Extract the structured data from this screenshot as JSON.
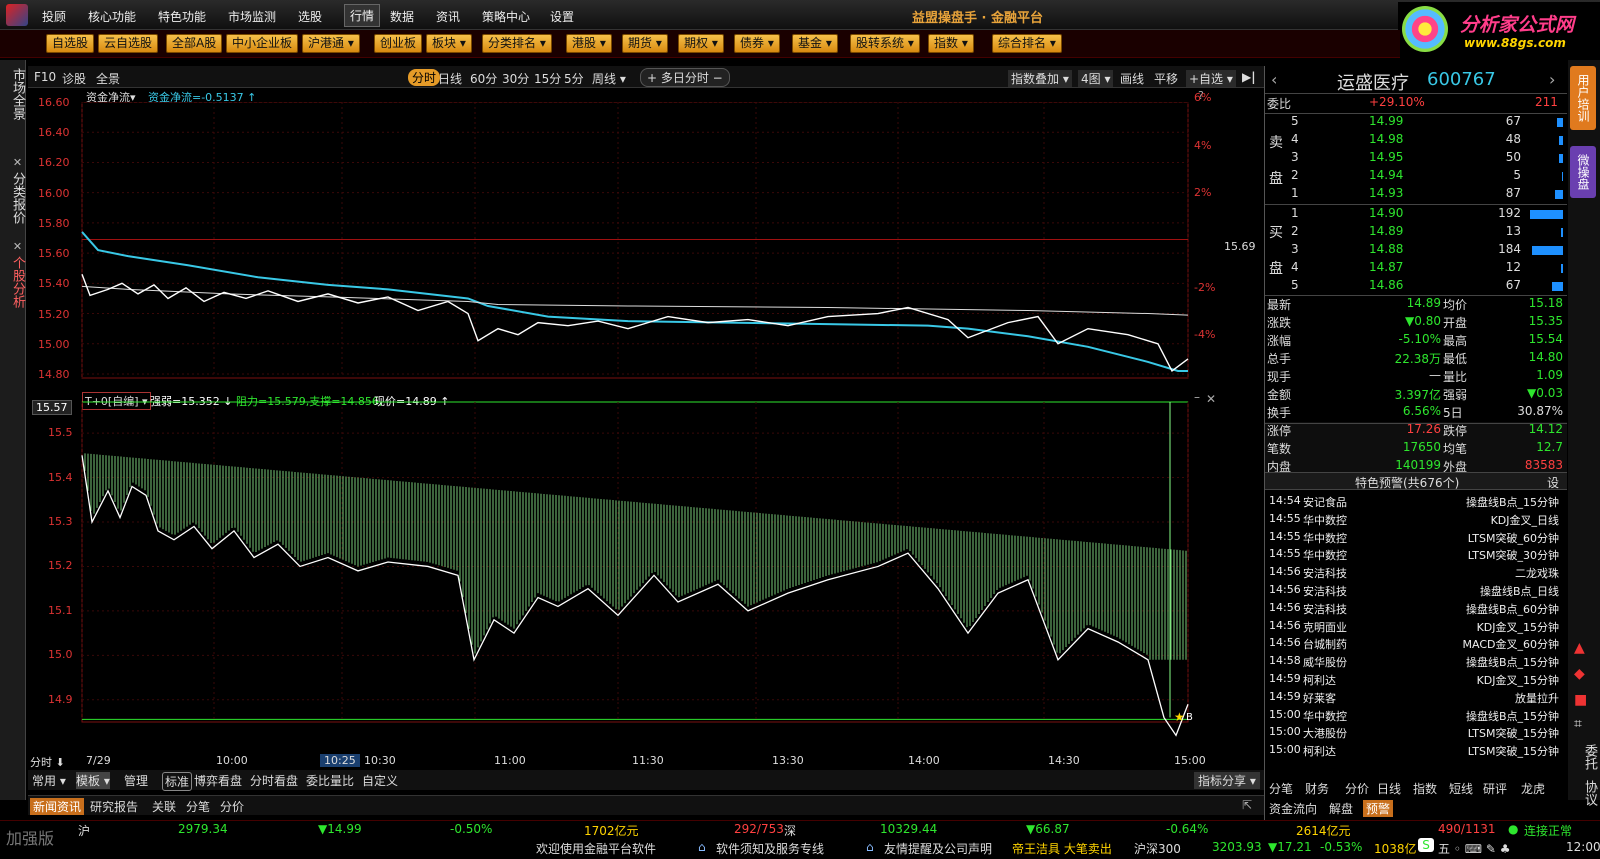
{
  "menu": {
    "items": [
      "投顾",
      "核心功能",
      "特色功能",
      "市场监测",
      "选股",
      "行情",
      "数据",
      "资讯",
      "策略中心",
      "设置"
    ],
    "active": "行情",
    "brand": "益盟操盘手 · 金融平台"
  },
  "site": {
    "name": "分析家公式网",
    "url": "www.88gs.com"
  },
  "toolbar": [
    "自选股",
    "云自选股",
    "全部A股",
    "中小企业板",
    "沪港通 ▾",
    "创业板",
    "板块 ▾",
    "分类排名 ▾",
    "港股 ▾",
    "期货 ▾",
    "期权 ▾",
    "债券 ▾",
    "基金 ▾",
    "股转系统 ▾",
    "指数 ▾",
    "综合排名 ▾"
  ],
  "left_tabs": [
    "市场全景",
    "分类报价",
    "个股分析"
  ],
  "right_tabs": [
    "用户培训",
    "微操盘"
  ],
  "right_icons": [
    "委托",
    "协议"
  ],
  "chart_bar": {
    "left": [
      "F10",
      "诊股",
      "全景"
    ],
    "periods": [
      "分时",
      "日线",
      "60分",
      "30分",
      "15分",
      "5分",
      "周线 ▾"
    ],
    "multiday": "+ 多日分时 −",
    "right": [
      "指数叠加 ▾",
      "4图 ▾",
      "画线",
      "平移",
      "+自选 ▾"
    ]
  },
  "upper_panel": {
    "indicator": "资金净流▾",
    "indicator_value": "资金净流=-0.5137 ↑",
    "price_ticks": [
      "16.60",
      "16.40",
      "16.20",
      "16.00",
      "15.80",
      "15.60",
      "15.40",
      "15.20",
      "15.00",
      "14.80"
    ],
    "pct_ticks": [
      "6%",
      "4%",
      "2%",
      "",
      "-2%",
      "-4%"
    ],
    "ref_price": "15.69",
    "help": "?"
  },
  "lower_panel": {
    "selector": "T+0[自编] ▾",
    "strength": "强弱=15.352 ↓",
    "resist": "阻力=15.579,支撑=14.856,",
    "price": "现价=14.89 ↑",
    "ticks": [
      "15.5",
      "15.4",
      "15.3",
      "15.2",
      "15.1",
      "15.0",
      "14.9"
    ],
    "top_value": "15.57",
    "marker": "B"
  },
  "time_axis": {
    "label": "分时 ⬇",
    "date": "7/29",
    "times": [
      "10:00",
      "10:25",
      "10:30",
      "11:00",
      "11:30",
      "13:30",
      "14:00",
      "14:30",
      "15:00"
    ]
  },
  "bottom_tabs": {
    "left": [
      "常用 ▾",
      "模板 ▾",
      "管理",
      "标准",
      "博弈看盘",
      "分时看盘",
      "委比量比",
      "自定义"
    ],
    "right": "指标分享 ▾"
  },
  "news_tabs": [
    "新闻资讯",
    "研究报告",
    "关联",
    "分笔",
    "分价"
  ],
  "quote": {
    "name": "运盛医疗",
    "code": "600767",
    "ratio_label": "委比",
    "ratio": "+29.10%",
    "ratio_num": "211",
    "sell": [
      {
        "lv": "5",
        "p": "14.99",
        "v": "67",
        "f": 0.1
      },
      {
        "lv": "4",
        "p": "14.98",
        "v": "48",
        "f": 0.07
      },
      {
        "lv": "3",
        "p": "14.95",
        "v": "50",
        "f": 0.07
      },
      {
        "lv": "2",
        "p": "14.94",
        "v": "5",
        "f": 0.02
      },
      {
        "lv": "1",
        "p": "14.93",
        "v": "87",
        "f": 0.13
      }
    ],
    "buy": [
      {
        "lv": "1",
        "p": "14.90",
        "v": "192",
        "f": 0.55
      },
      {
        "lv": "2",
        "p": "14.89",
        "v": "13",
        "f": 0.04
      },
      {
        "lv": "3",
        "p": "14.88",
        "v": "184",
        "f": 0.52
      },
      {
        "lv": "4",
        "p": "14.87",
        "v": "12",
        "f": 0.03
      },
      {
        "lv": "5",
        "p": "14.86",
        "v": "67",
        "f": 0.19
      }
    ],
    "sell_label": [
      "卖",
      "盘"
    ],
    "buy_label": [
      "买",
      "盘"
    ],
    "stats": [
      [
        "最新",
        "14.89",
        "均价",
        "15.18"
      ],
      [
        "涨跌",
        "▼0.80",
        "开盘",
        "15.35"
      ],
      [
        "涨幅",
        "-5.10%",
        "最高",
        "15.54"
      ],
      [
        "总手",
        "22.38万",
        "最低",
        "14.80"
      ],
      [
        "现手",
        "—",
        "量比",
        "1.09"
      ],
      [
        "金额",
        "3.397亿",
        "强弱",
        "▼0.03"
      ],
      [
        "换手",
        "6.56%",
        "5日",
        "30.87%"
      ],
      [
        "涨停",
        "17.26",
        "跌停",
        "14.12"
      ],
      [
        "笔数",
        "17650",
        "均笔",
        "12.7"
      ],
      [
        "内盘",
        "140199",
        "外盘",
        "83583"
      ]
    ]
  },
  "alerts": {
    "title": "特色预警(共676个)",
    "set": "设",
    "rows": [
      [
        "14:54",
        "安记食品",
        "操盘线B点_15分钟"
      ],
      [
        "14:55",
        "华中数控",
        "KDJ金叉_日线"
      ],
      [
        "14:55",
        "华中数控",
        "LTSM突破_60分钟"
      ],
      [
        "14:55",
        "华中数控",
        "LTSM突破_30分钟"
      ],
      [
        "14:56",
        "安洁科技",
        "二龙戏珠"
      ],
      [
        "14:56",
        "安洁科技",
        "操盘线B点_日线"
      ],
      [
        "14:56",
        "安洁科技",
        "操盘线B点_60分钟"
      ],
      [
        "14:56",
        "克明面业",
        "KDJ金叉_15分钟"
      ],
      [
        "14:56",
        "台城制药",
        "MACD金叉_60分钟"
      ],
      [
        "14:58",
        "威华股份",
        "操盘线B点_15分钟"
      ],
      [
        "14:59",
        "柯利达",
        "KDJ金叉_15分钟"
      ],
      [
        "14:59",
        "好莱客",
        "放量拉升"
      ],
      [
        "15:00",
        "华中数控",
        "操盘线B点_15分钟"
      ],
      [
        "15:00",
        "大港股份",
        "LTSM突破_15分钟"
      ],
      [
        "15:00",
        "柯利达",
        "LTSM突破_15分钟"
      ]
    ]
  },
  "right_bottom_tabs": [
    "分笔",
    "财务",
    "分价",
    "日线",
    "指数",
    "短线",
    "研评",
    "龙虎"
  ],
  "right_bottom_tabs2": [
    "资金流向",
    "解盘",
    "预警"
  ],
  "status": {
    "left_label": "加强版",
    "sh_label": "沪",
    "sh_index": "2979.34",
    "sh_change": "▼14.99",
    "sh_pct": "-0.50%",
    "sh_amount": "1702亿元",
    "sh_updown": "292/753",
    "sz_label": "深",
    "sz_index": "10329.44",
    "sz_change": "▼66.87",
    "sz_pct": "-0.64%",
    "sz_amount": "2614亿元",
    "sz_updown": "490/1131",
    "conn": "连接正常",
    "ticker": [
      "欢迎使用金融平台软件",
      "软件须知及服务专线",
      "友情提醒及公司声明"
    ],
    "ticker2": "帝王洁具 大笔卖出",
    "hs300_label": "沪深300",
    "hs300": "3203.93",
    "hs300_chg": "▼17.21",
    "hs300_pct": "-0.53%",
    "hs300_amt": "1038亿",
    "clock": "12:00"
  },
  "colors": {
    "up": "#ff4040",
    "down": "#2ee62e",
    "cyan": "#39c8e6",
    "bar": "#78c878"
  }
}
